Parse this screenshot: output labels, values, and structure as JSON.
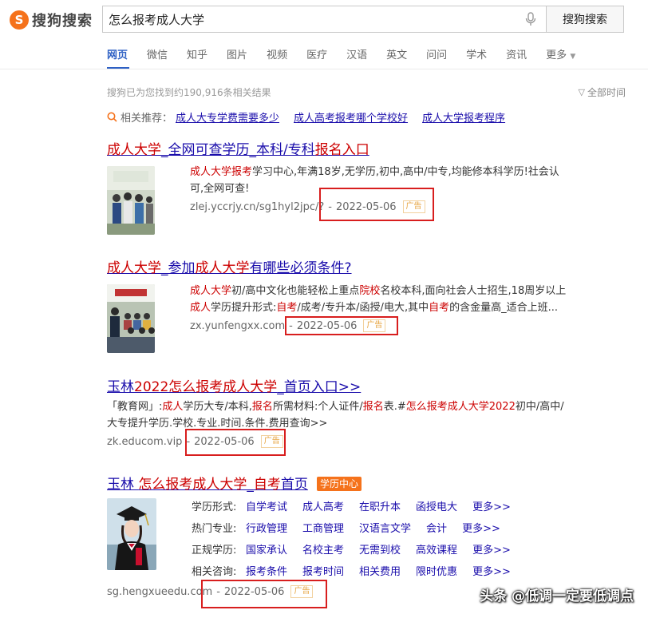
{
  "header": {
    "logo_text": "搜狗搜索",
    "search_value": "怎么报考成人大学",
    "search_button": "搜狗搜索"
  },
  "tabs": [
    "网页",
    "微信",
    "知乎",
    "图片",
    "视频",
    "医疗",
    "汉语",
    "英文",
    "问问",
    "学术",
    "资讯",
    "更多"
  ],
  "active_tab": "网页",
  "result_count": "搜狗已为您找到约190,916条相关结果",
  "time_filter": "全部时间",
  "related": {
    "label": "相关推荐：",
    "items": [
      "成人大专学费需要多少",
      "成人高考报考哪个学校好",
      "成人大学报考程序"
    ]
  },
  "colors": {
    "link": "#1a0dab",
    "highlight": "#c00000",
    "accent": "#f5721b",
    "annotation": "#d81e1e"
  },
  "results": [
    {
      "title_parts": [
        "成人大学",
        "_全网可查学历_本科/专科",
        "报名入口"
      ],
      "desc_line1": [
        "成人大学报考",
        "学习中心,年满18岁,无学历,初中,高中/中专,均能修本科学历!社会认"
      ],
      "desc_line2": "可,全网可查!",
      "url": "zlej.yccrjy.cn/sg1hyl2jpc/?",
      "date": "2022-05-06",
      "ad": "广告"
    },
    {
      "title_parts": [
        "成人大学",
        "_参加",
        "成人大学",
        "有哪些必须条件?"
      ],
      "desc_line1": [
        "成人大学",
        "初/高中文化也能轻松上重点",
        "院校",
        "名校本科,面向社会人士招生,18周岁以上"
      ],
      "desc_line2": [
        "成人",
        "学历提升形式:",
        "自考",
        "/成考/专升本/函授/电大,其中",
        "自考",
        "的含金量高_适合上班..."
      ],
      "url": "zx.yunfengxx.com",
      "date": "2022-05-06",
      "ad": "广告"
    },
    {
      "title_parts": [
        "玉林",
        "2022怎么报考成人大学",
        "_首页入口>>"
      ],
      "desc_line1": [
        "「教育网」:",
        "成人",
        "学历大专/本科,",
        "报名",
        "所需材料:个人证件/",
        "报名",
        "表.#",
        "怎么报考成人大学2022",
        "初中/高中/"
      ],
      "desc_line2": "大专提升学历.学校.专业.时间.条件.费用查询>>",
      "url": "zk.educom.vip",
      "date": "2022-05-06",
      "ad": "广告"
    },
    {
      "title_parts": [
        "玉林 ",
        "怎么报考成人大学",
        "_",
        "自考",
        "首页"
      ],
      "tag": "学历中心",
      "url": "sg.hengxueedu.com",
      "date": "2022-05-06",
      "ad": "广告"
    }
  ],
  "grid": [
    {
      "label": "学历形式:",
      "items": [
        "自学考试",
        "成人高考",
        "在职升本",
        "函授电大",
        "更多>>"
      ]
    },
    {
      "label": "热门专业:",
      "items": [
        "行政管理",
        "工商管理",
        "汉语言文学",
        "会计",
        "更多>>"
      ]
    },
    {
      "label": "正规学历:",
      "items": [
        "国家承认",
        "名校主考",
        "无需到校",
        "高效课程",
        "更多>>"
      ]
    },
    {
      "label": "相关咨询:",
      "items": [
        "报考条件",
        "报考时间",
        "相关费用",
        "限时优惠",
        "更多>>"
      ]
    }
  ],
  "watermark": "头条 @低调一定要低调点"
}
